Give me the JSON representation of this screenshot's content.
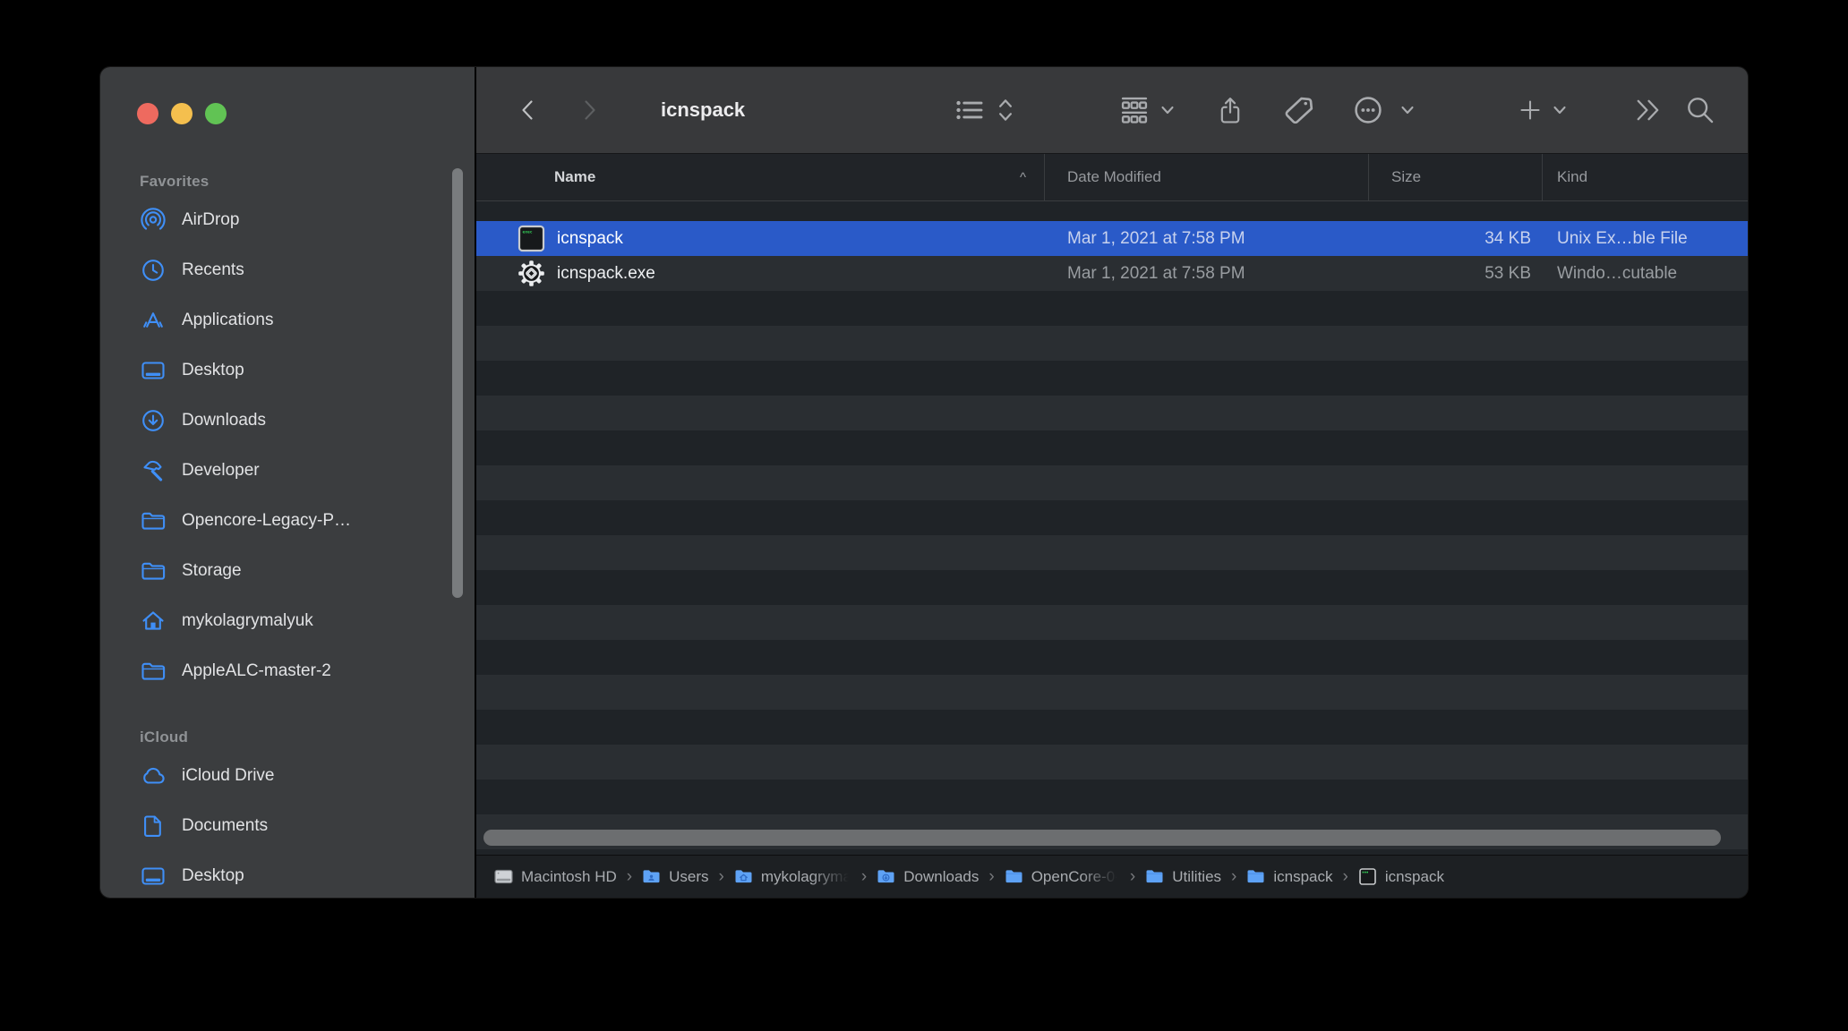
{
  "window": {
    "title": "icnspack"
  },
  "traffic_lights": {
    "close": "#ee6a5f",
    "minimize": "#f4bf4e",
    "zoom": "#61c354"
  },
  "toolbar": {
    "buttons": [
      {
        "name": "back",
        "icon": "chevron-left-icon"
      },
      {
        "name": "forward",
        "icon": "chevron-right-icon"
      },
      {
        "name": "view-list",
        "icon": "list-view-icon"
      },
      {
        "name": "view-sort",
        "icon": "sort-chevrons-icon"
      },
      {
        "name": "group-by",
        "icon": "group-view-icon"
      },
      {
        "name": "group-chevron",
        "icon": "chevron-down-icon"
      },
      {
        "name": "share",
        "icon": "share-icon"
      },
      {
        "name": "tags",
        "icon": "tag-icon"
      },
      {
        "name": "more-actions",
        "icon": "ellipsis-circle-icon"
      },
      {
        "name": "more-chevron",
        "icon": "chevron-down-icon"
      },
      {
        "name": "new-item",
        "icon": "plus-icon"
      },
      {
        "name": "new-chevron",
        "icon": "chevron-down-icon"
      },
      {
        "name": "overflow",
        "icon": "double-chevron-icon"
      },
      {
        "name": "search",
        "icon": "magnifier-icon"
      }
    ]
  },
  "sidebar": {
    "sections": [
      {
        "label": "Favorites",
        "items": [
          {
            "icon": "airdrop",
            "label": "AirDrop"
          },
          {
            "icon": "clock",
            "label": "Recents"
          },
          {
            "icon": "appstore",
            "label": "Applications"
          },
          {
            "icon": "desktop",
            "label": "Desktop"
          },
          {
            "icon": "download",
            "label": "Downloads"
          },
          {
            "icon": "hammer",
            "label": "Developer"
          },
          {
            "icon": "folder",
            "label": "Opencore-Legacy-P…"
          },
          {
            "icon": "folder",
            "label": "Storage"
          },
          {
            "icon": "home",
            "label": "mykolagrymalyuk"
          },
          {
            "icon": "folder",
            "label": "AppleALC-master-2"
          }
        ]
      },
      {
        "label": "iCloud",
        "items": [
          {
            "icon": "cloud",
            "label": "iCloud Drive"
          },
          {
            "icon": "document",
            "label": "Documents"
          },
          {
            "icon": "desktop",
            "label": "Desktop"
          }
        ]
      }
    ]
  },
  "columns": [
    {
      "label": "Name",
      "sorted": true,
      "sort_indicator": "^"
    },
    {
      "label": "Date Modified"
    },
    {
      "label": "Size"
    },
    {
      "label": "Kind"
    }
  ],
  "files": [
    {
      "icon": "exec-file",
      "name": "icnspack",
      "date_modified": "Mar 1, 2021 at 7:58 PM",
      "size": "34 KB",
      "kind": "Unix Ex…ble File",
      "selected": true
    },
    {
      "icon": "exe-gear",
      "name": "icnspack.exe",
      "date_modified": "Mar 1, 2021 at 7:58 PM",
      "size": "53 KB",
      "kind": "Windo…cutable",
      "selected": false
    }
  ],
  "pathbar": [
    {
      "icon": "drive",
      "label": "Macintosh HD"
    },
    {
      "icon": "folder-users",
      "label": "Users"
    },
    {
      "icon": "folder-home",
      "label": "mykolagryma",
      "truncated": true
    },
    {
      "icon": "folder-download",
      "label": "Downloads"
    },
    {
      "icon": "folder-plain",
      "label": "OpenCore-0-",
      "truncated": true
    },
    {
      "icon": "folder-plain",
      "label": "Utilities"
    },
    {
      "icon": "folder-plain",
      "label": "icnspack"
    },
    {
      "icon": "exec-mini",
      "label": "icnspack"
    }
  ],
  "colors": {
    "selection": "#2a5ac8",
    "sidebar_accent": "#3f8ff7"
  }
}
